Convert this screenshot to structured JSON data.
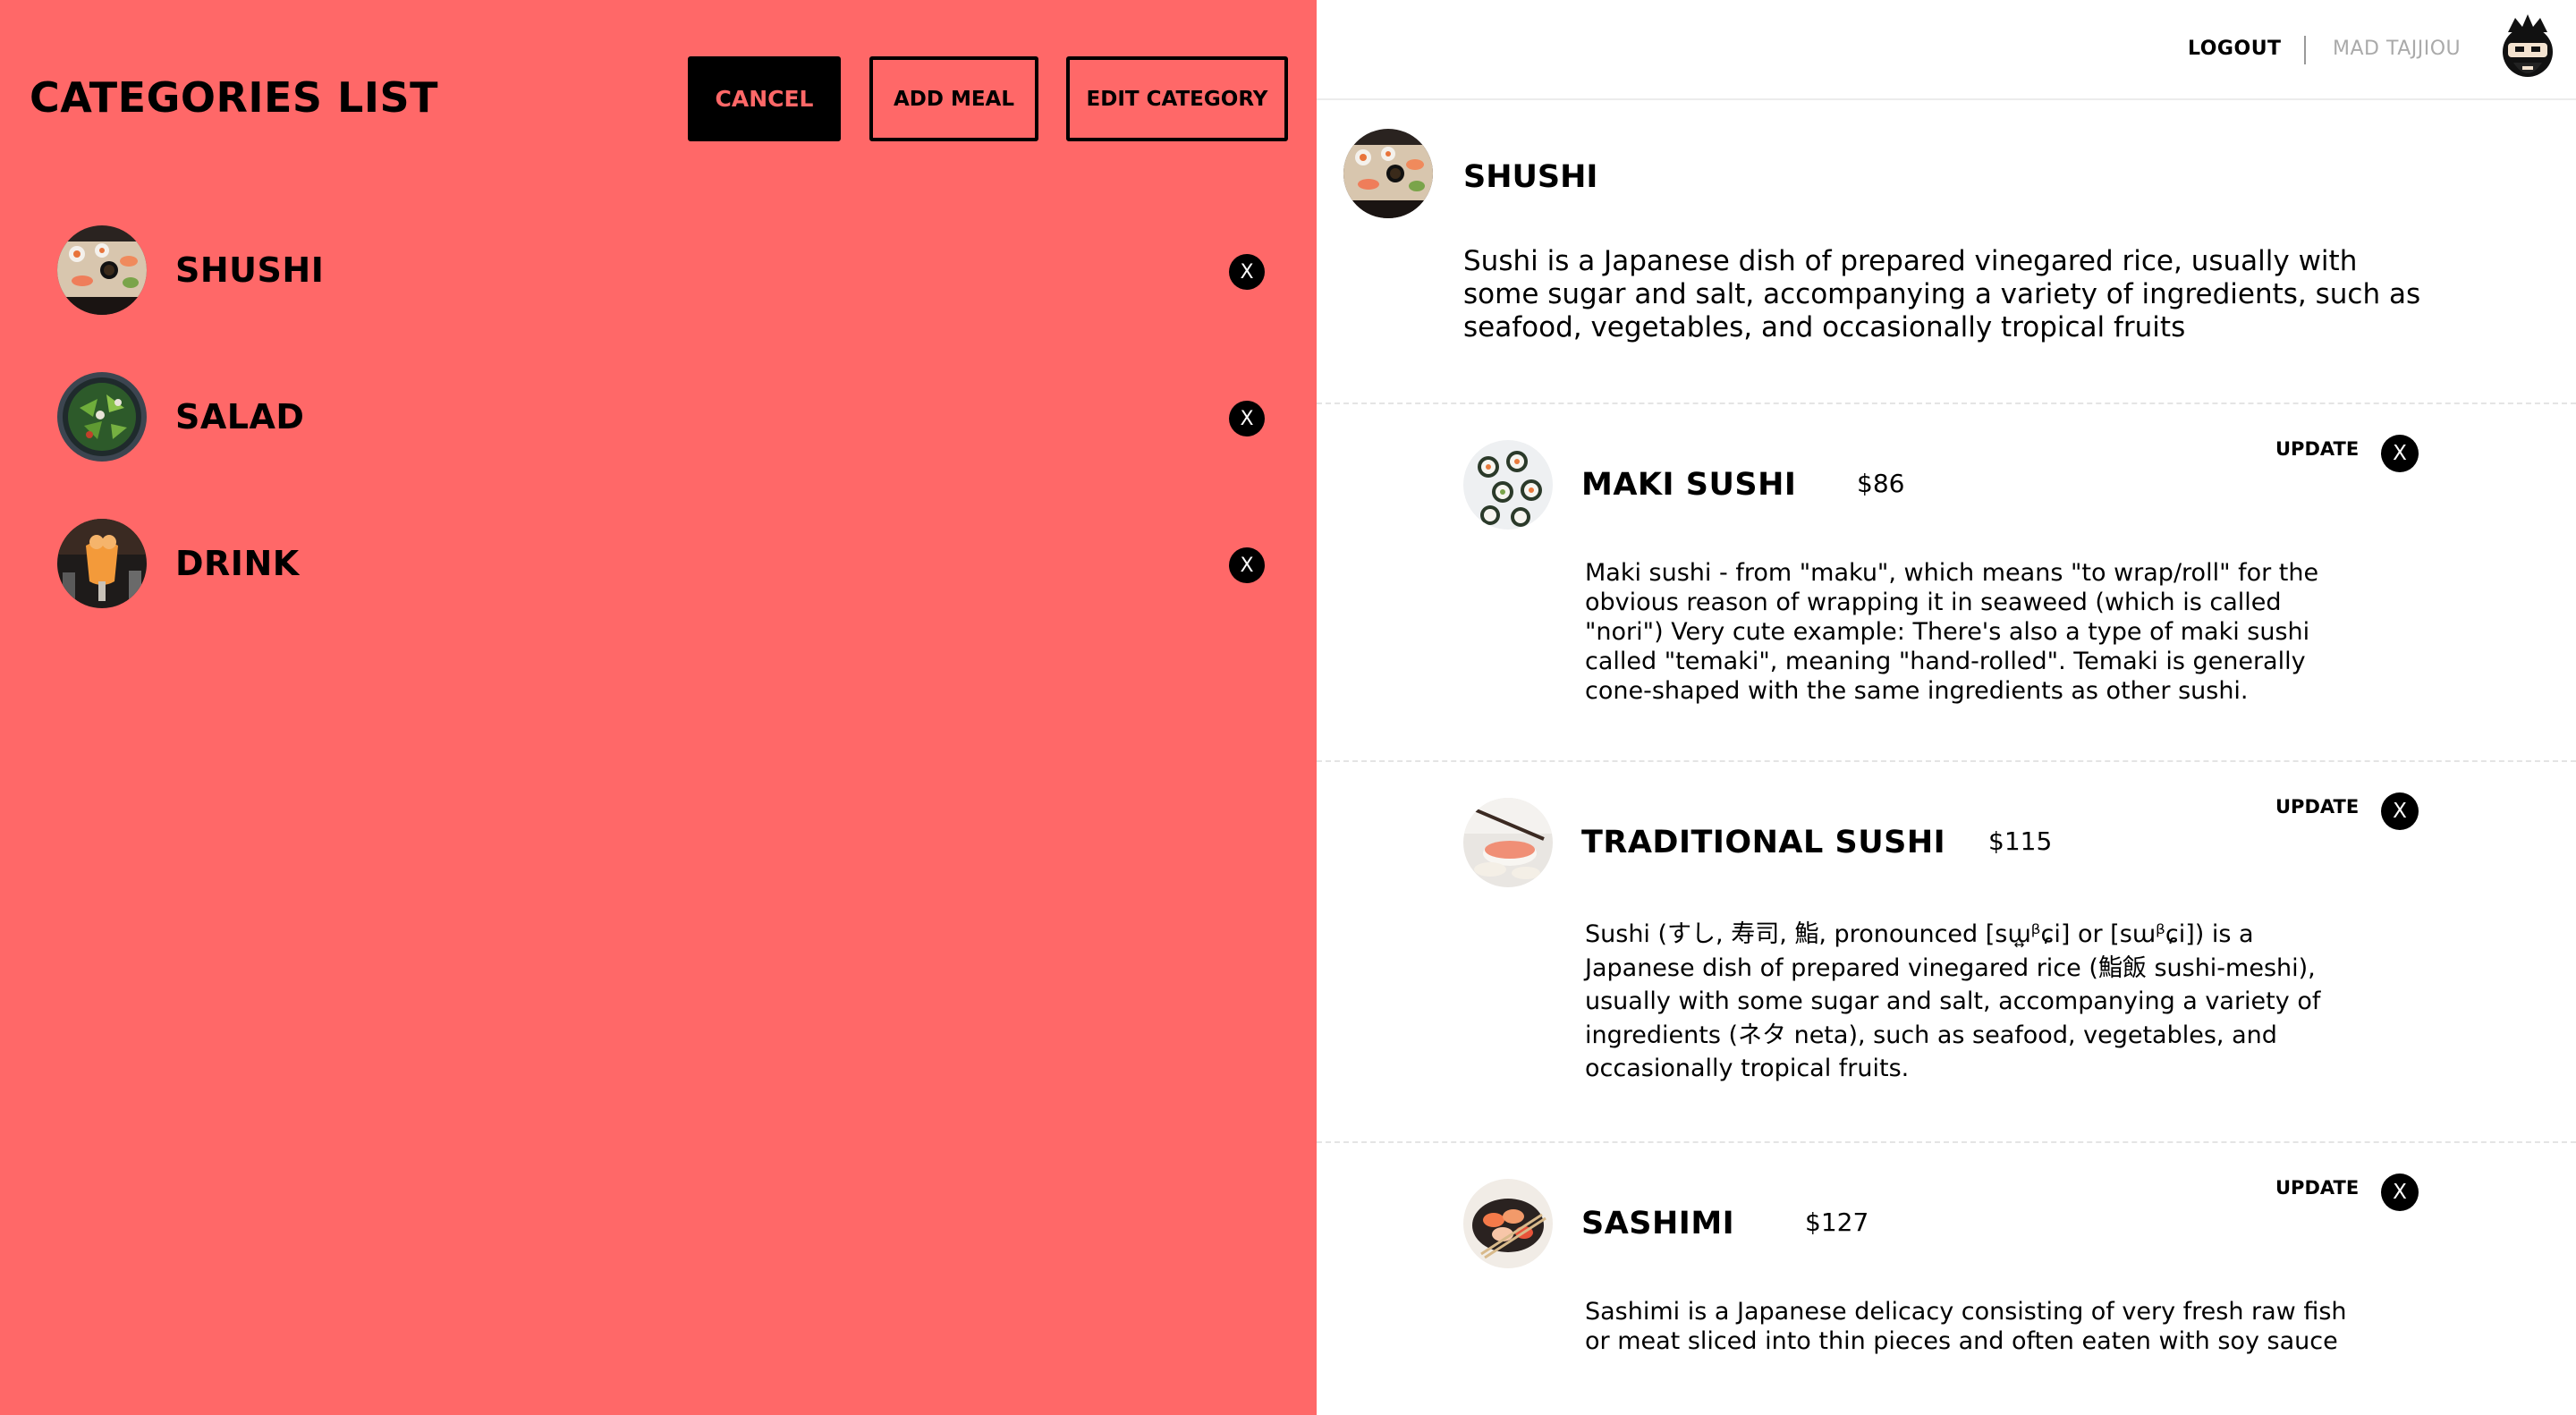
{
  "left_panel": {
    "title": "CATEGORIES LIST",
    "buttons": {
      "cancel": "CANCEL",
      "add_meal": "ADD MEAL",
      "edit_category": "EDIT CATEGORY"
    },
    "categories": [
      {
        "label": "SHUSHI",
        "remove": "X",
        "image_icon": "sushi-plate"
      },
      {
        "label": "SALAD",
        "remove": "X",
        "image_icon": "salad-bowl"
      },
      {
        "label": "DRINK",
        "remove": "X",
        "image_icon": "drink-glass"
      }
    ]
  },
  "header": {
    "logout": "LOGOUT",
    "username": "MAD TAJJIOU",
    "avatar_icon": "ninja-avatar"
  },
  "category_detail": {
    "title": "SHUSHI",
    "description": "Sushi is a Japanese dish of prepared vinegared rice, usually with some sugar and salt, accompanying a variety of ingredients, such as seafood, vegetables, and occasionally tropical fruits"
  },
  "meals": [
    {
      "name": "MAKI SUSHI",
      "price": "$86",
      "update": "UPDATE",
      "remove": "X",
      "description": "Maki sushi - from \"maku\", which means \"to wrap/roll\" for the obvious reason of wrapping it in seaweed (which is called \"nori\") Very cute example: There's also a type of maki sushi called \"temaki\", meaning \"hand-rolled\". Temaki is generally cone-shaped with the same ingredients as other sushi."
    },
    {
      "name": "TRADITIONAL SUSHI",
      "price": "$115",
      "update": "UPDATE",
      "remove": "X",
      "description": "Sushi (すし, 寿司, 鮨, pronounced [sɯ͍ᵝɕi] or [sɯᵝɕi]) is a Japanese dish of prepared vinegared rice (鮨飯 sushi-meshi), usually with some sugar and salt, accompanying a variety of ingredients (ネタ neta), such as seafood, vegetables, and occasionally tropical fruits."
    },
    {
      "name": "SASHIMI",
      "price": "$127",
      "update": "UPDATE",
      "remove": "X",
      "description": "Sashimi is a Japanese delicacy consisting of very fresh raw fish or meat sliced into thin pieces and often eaten with soy sauce"
    }
  ],
  "colors": {
    "accent": "#ff6868",
    "text": "#000000",
    "muted": "#aaaaaa"
  }
}
